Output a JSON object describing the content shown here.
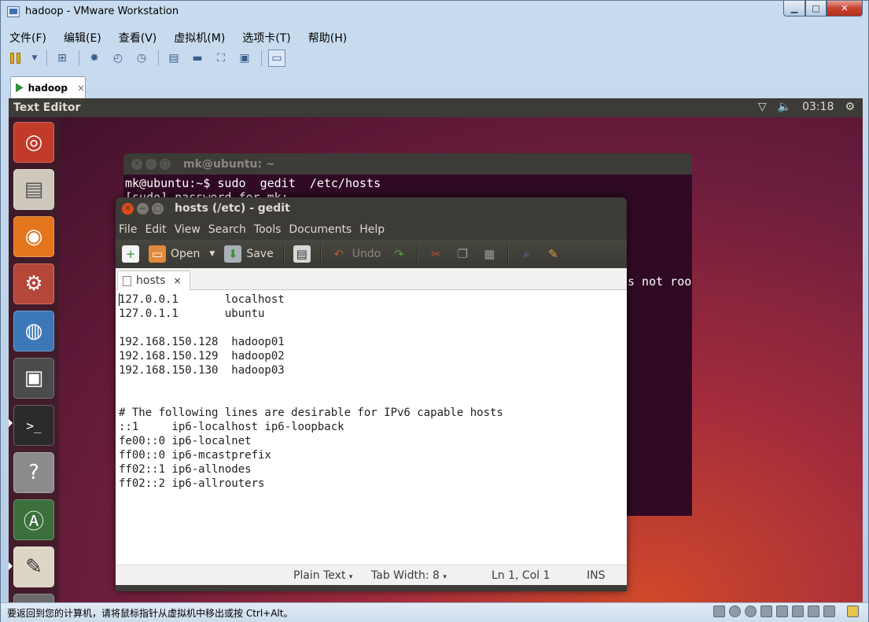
{
  "window": {
    "title": "hadoop - VMware Workstation"
  },
  "vm_menu": [
    "文件(F)",
    "编辑(E)",
    "查看(V)",
    "虚拟机(M)",
    "选项卡(T)",
    "帮助(H)"
  ],
  "vm_tab": {
    "label": "hadoop",
    "close": "×"
  },
  "guest": {
    "app_title": "Text Editor",
    "clock": "03:18",
    "terminal": {
      "title": "mk@ubuntu: ~",
      "lines": [
        "mk@ubuntu:~$ sudo  gedit  /etc/hosts",
        "[sudo] password for mk:"
      ],
      "tail": "s not roo"
    },
    "gedit": {
      "title": "hosts (/etc) - gedit",
      "menu": [
        "File",
        "Edit",
        "View",
        "Search",
        "Tools",
        "Documents",
        "Help"
      ],
      "toolbar": {
        "open": "Open",
        "save": "Save",
        "undo": "Undo"
      },
      "tab": {
        "label": "hosts",
        "close": "×"
      },
      "lines": [
        "127.0.0.1       localhost",
        "127.0.1.1       ubuntu",
        "",
        "192.168.150.128  hadoop01",
        "192.168.150.129  hadoop02",
        "192.168.150.130  hadoop03",
        "",
        "",
        "# The following lines are desirable for IPv6 capable hosts",
        "::1     ip6-localhost ip6-loopback",
        "fe00::0 ip6-localnet",
        "ff00::0 ip6-mcastprefix",
        "ff02::1 ip6-allnodes",
        "ff02::2 ip6-allrouters"
      ],
      "status": {
        "syntax": "Plain Text",
        "tab_width": "Tab Width: 8",
        "position": "Ln 1, Col 1",
        "mode": "INS"
      }
    }
  },
  "statusbar": {
    "text": "要返回到您的计算机，请将鼠标指针从虚拟机中移出或按 Ctrl+Alt。"
  }
}
